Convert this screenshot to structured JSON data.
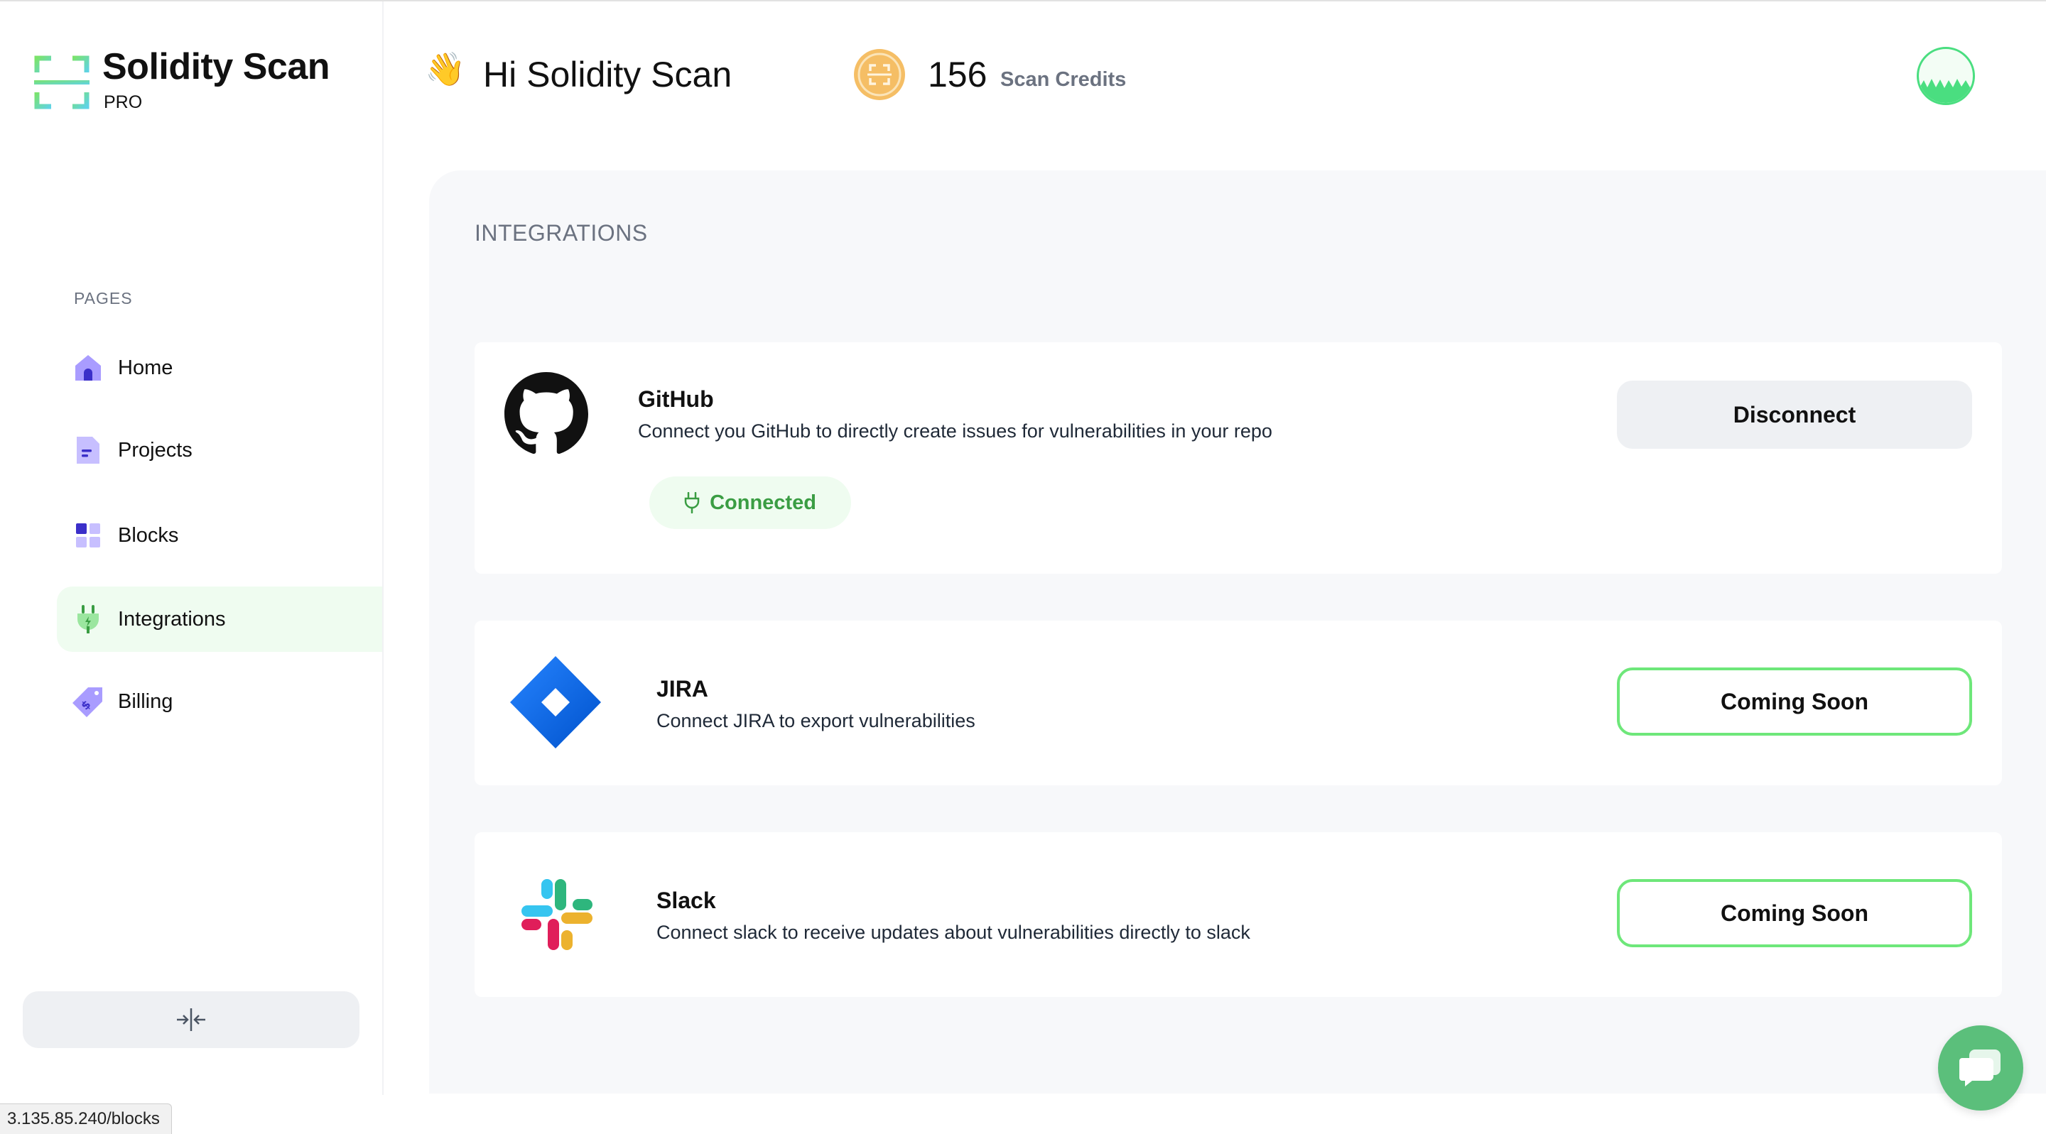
{
  "app": {
    "name": "Solidity Scan",
    "plan": "PRO"
  },
  "header": {
    "greeting": "Hi Solidity Scan",
    "credits_value": "156",
    "credits_label": "Scan Credits"
  },
  "sidebar": {
    "section_label": "PAGES",
    "items": [
      {
        "label": "Home",
        "icon": "home-icon"
      },
      {
        "label": "Projects",
        "icon": "document-icon"
      },
      {
        "label": "Blocks",
        "icon": "grid-icon"
      },
      {
        "label": "Integrations",
        "icon": "plug-icon",
        "active": true
      },
      {
        "label": "Billing",
        "icon": "price-tag-icon"
      }
    ],
    "collapse_icon": "collapse-arrows-icon"
  },
  "main": {
    "title": "INTEGRATIONS",
    "integrations": [
      {
        "name": "GitHub",
        "description": "Connect you GitHub to directly create issues for vulnerabilities in your repo",
        "status": "Connected",
        "action": "Disconnect"
      },
      {
        "name": "JIRA",
        "description": "Connect JIRA to export vulnerabilities",
        "action": "Coming Soon"
      },
      {
        "name": "Slack",
        "description": "Connect slack to receive updates about vulnerabilities directly to slack",
        "action": "Coming Soon"
      }
    ]
  },
  "status_bar": {
    "url": "3.135.85.240/blocks"
  },
  "colors": {
    "accent_green": "#4ade80",
    "active_bg": "#effcf0",
    "connected_text": "#3a9d43",
    "nav_purple": "#6d5dfc"
  }
}
